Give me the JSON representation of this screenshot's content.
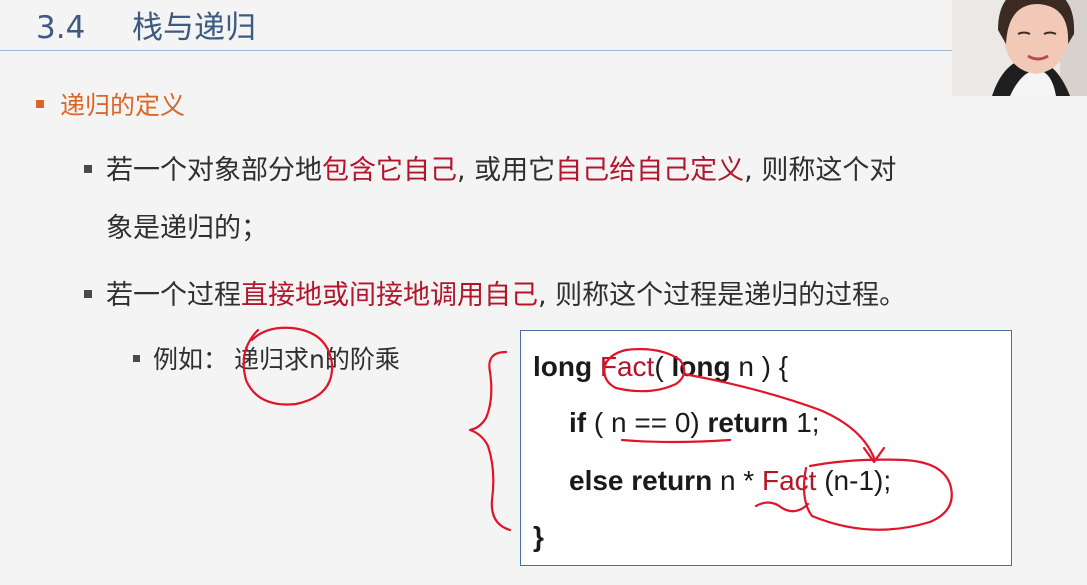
{
  "slide": {
    "section_number": "3.4",
    "section_title": "栈与递归",
    "heading": "递归的定义",
    "point1": {
      "part1": "若一个对象部分地",
      "emph1": "包含它自己",
      "part2": ", 或用它",
      "emph2": "自己给自己定义",
      "part3": ", 则称这个对",
      "continuation": "象是递归的；"
    },
    "point2": {
      "part1": "若一个过程",
      "emph": "直接地或间接地调用自己",
      "part2": ", 则称这个过程是递归的过程。"
    },
    "example": {
      "label": "例如：",
      "text": "递归求n的阶乘"
    }
  },
  "code": {
    "line1": {
      "kw1": "long",
      "fn": "Fact",
      "paren": "(",
      "kw2": "long",
      "rest": " n ) {"
    },
    "line2": {
      "kw1": "if",
      "cond": " ( n == 0) ",
      "kw2": "return",
      "num": " 1;"
    },
    "line3": {
      "kw1": "else return",
      "mid": " n * ",
      "fn": "Fact",
      "rest": " (n-1);"
    },
    "line4": {
      "close": "}"
    }
  },
  "colors": {
    "title": "#3d5a80",
    "heading_accent": "#d9672a",
    "emphasis_red": "#b2162a",
    "annotation_ink": "#e0142a",
    "code_border": "#4a6fa5"
  }
}
